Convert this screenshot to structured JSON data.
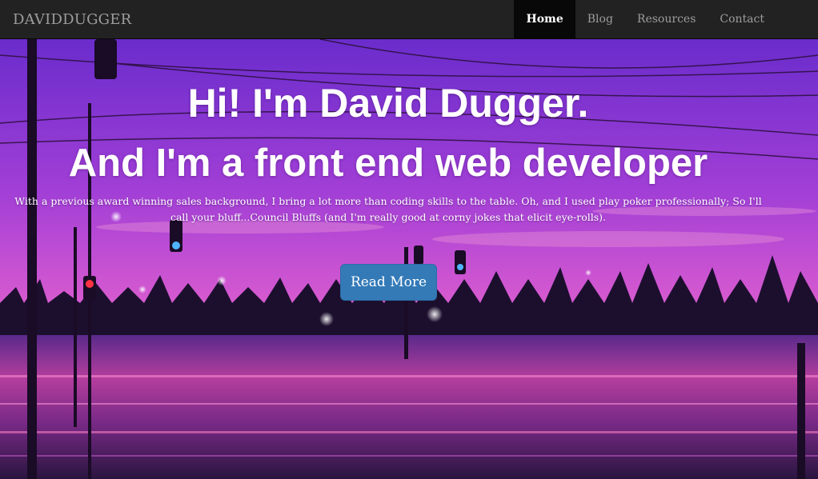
{
  "navbar": {
    "brand": "DAVIDDUGGER",
    "items": [
      {
        "label": "Home",
        "active": true
      },
      {
        "label": "Blog",
        "active": false
      },
      {
        "label": "Resources",
        "active": false
      },
      {
        "label": "Contact",
        "active": false
      }
    ]
  },
  "hero": {
    "headline_line1": "Hi! I'm David Dugger.",
    "headline_line2": "And I'm a front end web developer",
    "intro": "With a previous award winning sales background, I bring a lot more than coding skills to the table. Oh, and I used play poker professionally; So I'll call your bluff...Council Bluffs (and I'm really good at corny jokes that elicit eye-rolls).",
    "button_label": "Read More",
    "background_icon": "sunset-street-illustration"
  },
  "colors": {
    "navbar_bg": "#222222",
    "nav_text": "#9d9d9d",
    "active_bg": "#080808",
    "button_bg": "#337ab7",
    "sky_top": "#7a2fd0",
    "sky_mid": "#c24ad6",
    "horizon": "#f47bc0"
  }
}
